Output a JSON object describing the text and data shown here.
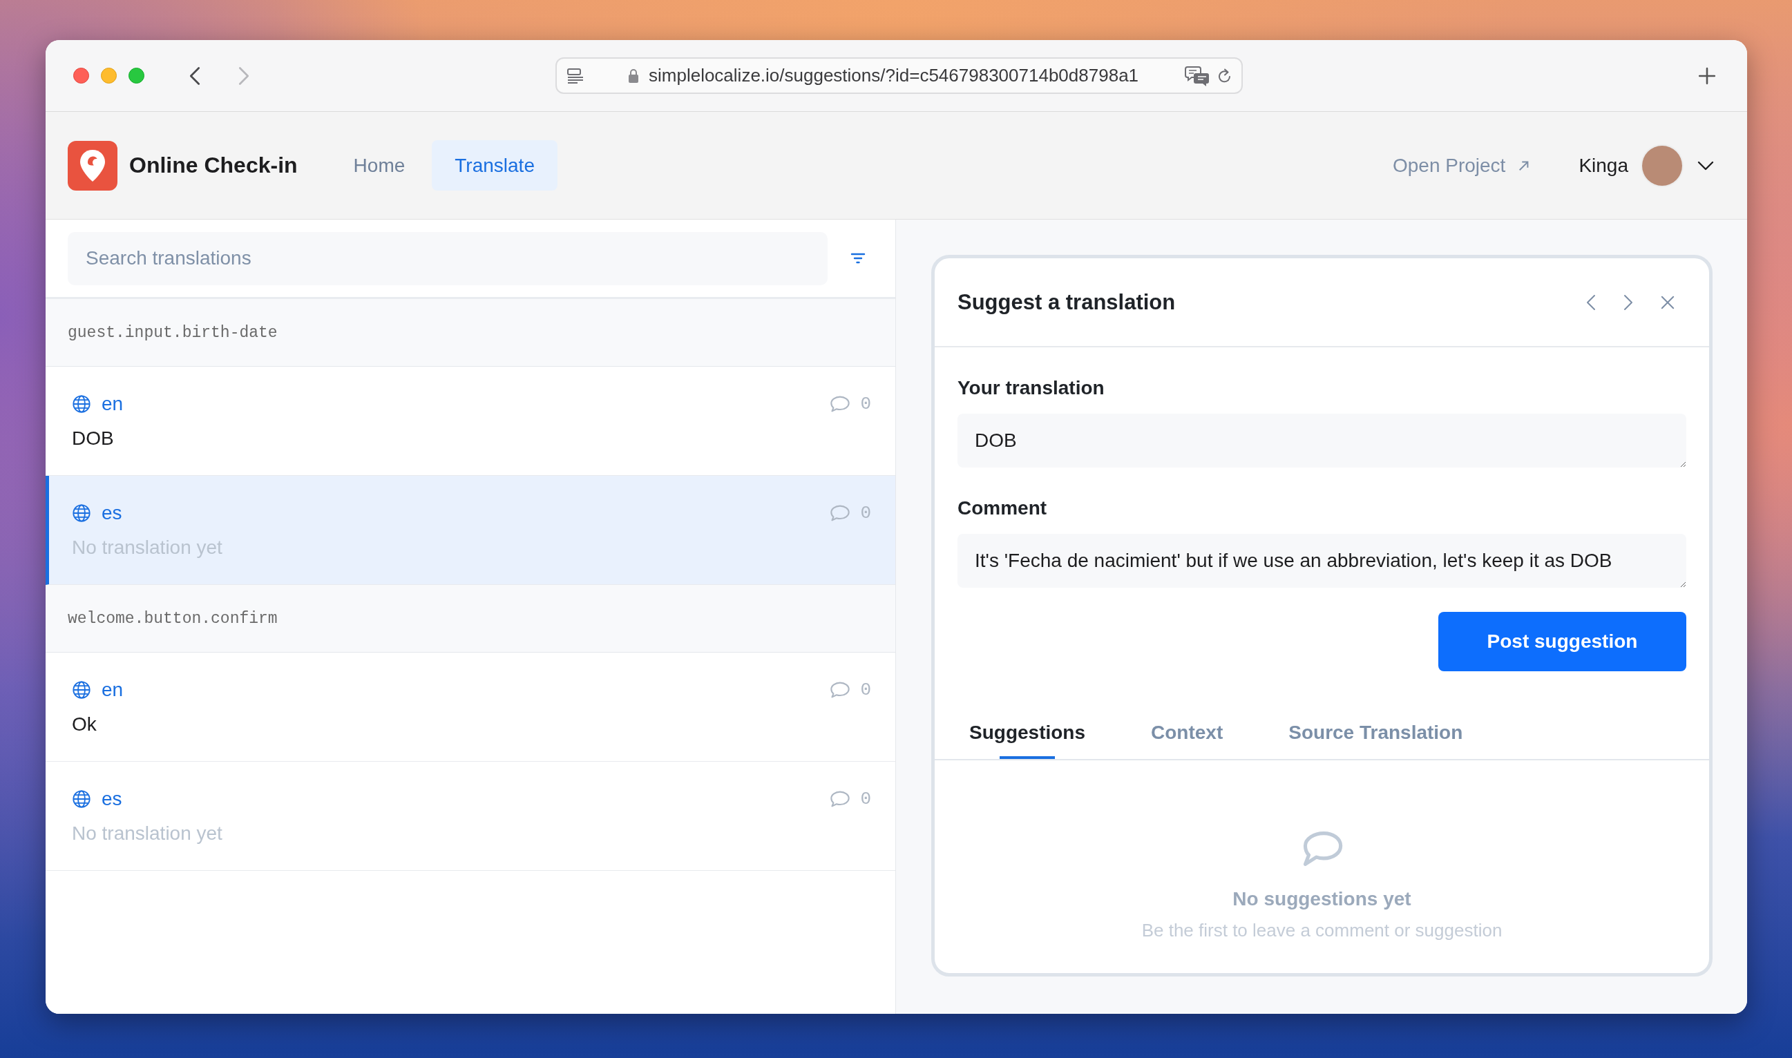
{
  "browser": {
    "nav": [
      {
        "kind": "back",
        "disabled": false
      },
      {
        "kind": "forward",
        "disabled": true
      }
    ],
    "url": "simplelocalize.io/suggestions/?id=c546798300714b0d8798a1"
  },
  "app": {
    "name": "Online Check-in",
    "nav": [
      {
        "label": "Home",
        "selected": false
      },
      {
        "label": "Translate",
        "selected": true
      }
    ],
    "open_project": "Open Project",
    "user": "Kinga"
  },
  "search": {
    "placeholder": "Search translations"
  },
  "groups": [
    {
      "key": "guest.input.birth-date",
      "rows": [
        {
          "lang": "en",
          "text": "DOB",
          "missing": false,
          "comments": "0",
          "selected": false
        },
        {
          "lang": "es",
          "text": "No translation yet",
          "missing": true,
          "comments": "0",
          "selected": true
        }
      ]
    },
    {
      "key": "welcome.button.confirm",
      "rows": [
        {
          "lang": "en",
          "text": "Ok",
          "missing": false,
          "comments": "0",
          "selected": false
        },
        {
          "lang": "es",
          "text": "No translation yet",
          "missing": true,
          "comments": "0",
          "selected": false
        }
      ]
    }
  ],
  "panel": {
    "title": "Suggest a translation",
    "fields": [
      {
        "label": "Your translation",
        "value": "DOB"
      },
      {
        "label": "Comment",
        "value": "It's 'Fecha de nacimient' but if we use an abbreviation, let's keep it as DOB"
      }
    ],
    "submit": "Post suggestion",
    "tabs": [
      {
        "label": "Suggestions",
        "selected": true
      },
      {
        "label": "Context",
        "selected": false
      },
      {
        "label": "Source Translation",
        "selected": false
      }
    ],
    "empty_state": {
      "title": "No suggestions yet",
      "subtitle": "Be the first to leave a comment or suggestion"
    }
  }
}
